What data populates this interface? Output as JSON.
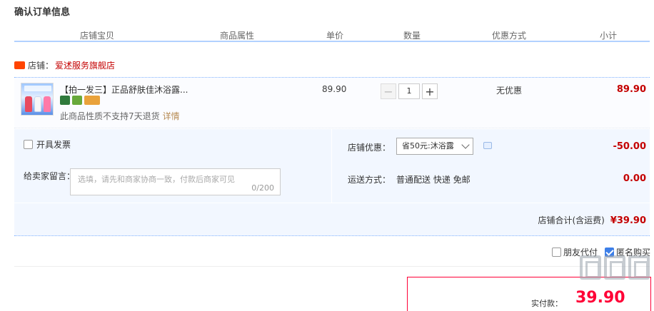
{
  "page": {
    "title": "确认订单信息"
  },
  "columns": [
    "店铺宝贝",
    "商品属性",
    "单价",
    "数量",
    "优惠方式",
    "小计"
  ],
  "shop": {
    "label": "店铺：",
    "name": "爱述服务旗舰店"
  },
  "item": {
    "title": "【拍一发三】正品舒肤佳沐浴露...",
    "note": "此商品性质不支持7天退货",
    "note_link": "详情",
    "unit_price": "89.90",
    "quantity": "1",
    "minus": "−",
    "plus": "+",
    "promo": "无优惠",
    "subtotal": "89.90"
  },
  "invoice": {
    "label": "开具发票"
  },
  "message": {
    "label": "给卖家留言：",
    "placeholder": "选填，请先和商家协商一致，付款后商家可见",
    "count": "0/200"
  },
  "coupon": {
    "label": "店铺优惠：",
    "selected": "省50元:沐浴露",
    "amount": "-50.00"
  },
  "shipping": {
    "label": "运送方式：",
    "value": "普通配送 快递 免邮",
    "amount": "0.00"
  },
  "shop_total": {
    "label": "店铺合计(含运费)",
    "amount": "¥39.90"
  },
  "options": {
    "friend_pay": {
      "label": "朋友代付",
      "checked": false
    },
    "anonymous": {
      "label": "匿名购买",
      "checked": true
    }
  },
  "payment": {
    "label": "实付款：",
    "amount": "39.90"
  },
  "colors": {
    "accent": "#c40000",
    "header_border": "#b2d1ff",
    "panel_bg": "#f2f7ff",
    "pay_border": "#ff0036"
  }
}
